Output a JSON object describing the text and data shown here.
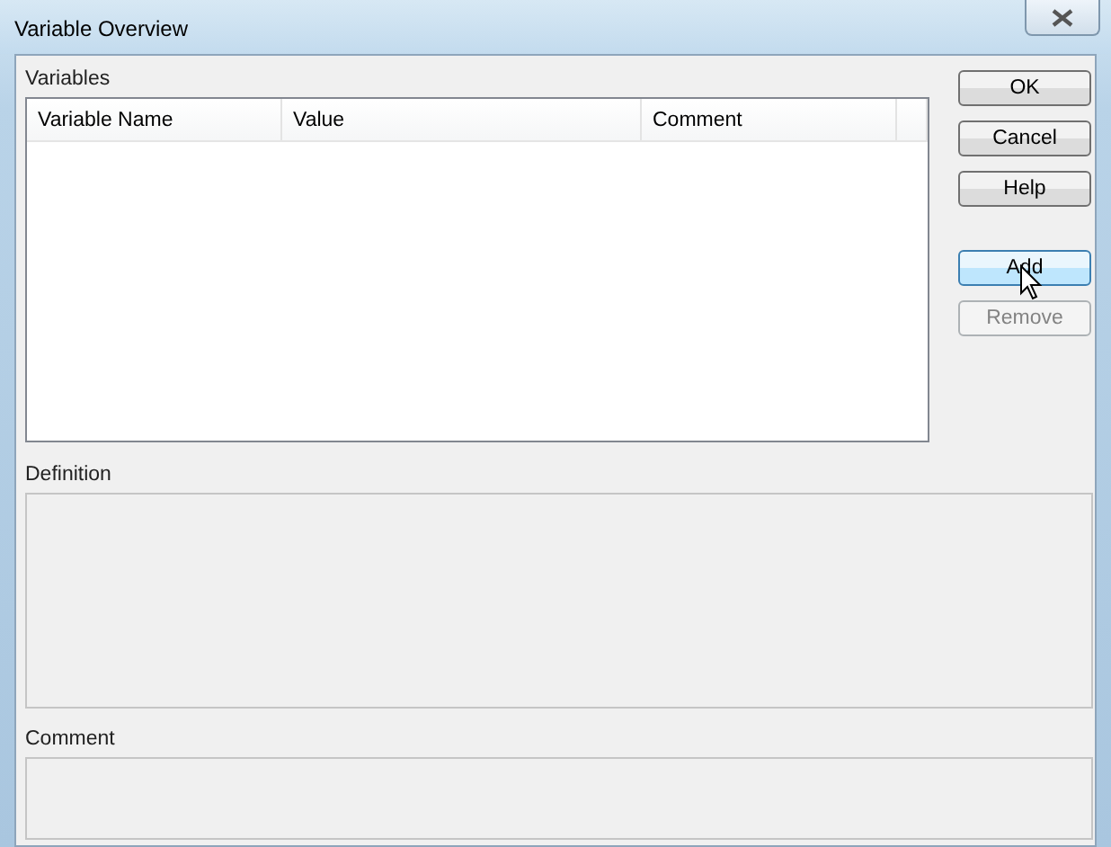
{
  "window": {
    "title": "Variable Overview"
  },
  "variables": {
    "label": "Variables",
    "columns": [
      "Variable Name",
      "Value",
      "Comment"
    ]
  },
  "definition": {
    "label": "Definition",
    "disabled": true
  },
  "comment": {
    "label": "Comment",
    "disabled": true
  },
  "buttons": [
    {
      "label": "OK",
      "disabled": false,
      "hovered": false
    },
    {
      "label": "Cancel",
      "disabled": false,
      "hovered": false
    },
    {
      "label": "Help",
      "disabled": false,
      "hovered": false
    },
    {
      "label": "Add",
      "disabled": false,
      "hovered": true
    },
    {
      "label": "Remove",
      "disabled": true,
      "hovered": false
    }
  ]
}
